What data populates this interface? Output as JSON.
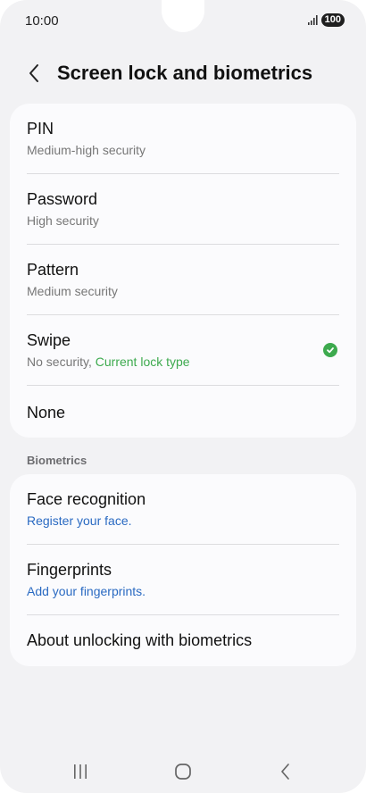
{
  "status": {
    "time": "10:00",
    "battery": "100"
  },
  "header": {
    "title": "Screen lock and biometrics"
  },
  "lock_types": [
    {
      "title": "PIN",
      "subtitle": "Medium-high security"
    },
    {
      "title": "Password",
      "subtitle": "High security"
    },
    {
      "title": "Pattern",
      "subtitle": "Medium security"
    },
    {
      "title": "Swipe",
      "subtitle": "No security, ",
      "subtitle_status": "Current lock type",
      "selected": true
    },
    {
      "title": "None"
    }
  ],
  "biometrics": {
    "section_label": "Biometrics",
    "items": [
      {
        "title": "Face recognition",
        "subtitle": "Register your face."
      },
      {
        "title": "Fingerprints",
        "subtitle": "Add your fingerprints."
      },
      {
        "title": "About unlocking with biometrics"
      }
    ]
  },
  "colors": {
    "accent_green": "#3daa4e",
    "link_blue": "#2a6ac2",
    "background": "#f2f2f4",
    "card": "#fbfbfd"
  },
  "icons": {
    "back": "chevron-left-icon",
    "selected": "check-circle-icon",
    "signal": "signal-icon",
    "nav_recents": "recents-icon",
    "nav_home": "home-icon",
    "nav_back": "back-icon"
  }
}
